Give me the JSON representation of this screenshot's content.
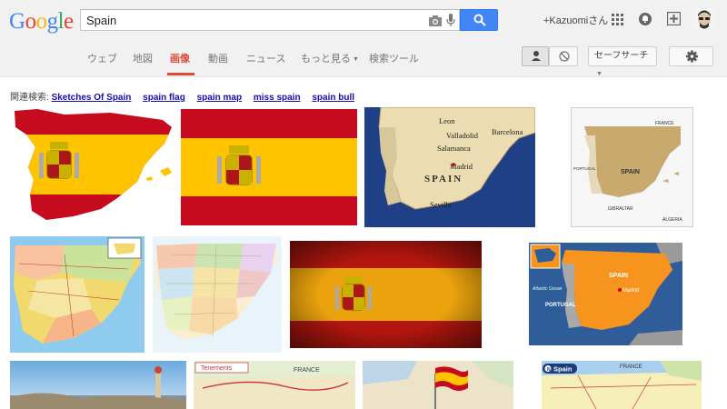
{
  "logo": {
    "text": "Google"
  },
  "search": {
    "query": "Spain"
  },
  "user": {
    "name": "+Kazuomiさん"
  },
  "nav": {
    "items": [
      "ウェブ",
      "地図",
      "画像",
      "動画",
      "ニュース",
      "もっと見る",
      "検索ツール"
    ],
    "active_index": 2
  },
  "toolbar": {
    "safe_search_label": "セーフサーチ"
  },
  "related": {
    "label": "関連検索:",
    "links": [
      "Sketches Of Spain",
      "spain flag",
      "spain map",
      "miss spain",
      "spain bull"
    ]
  },
  "images": [
    {
      "name": "spain-flag-map-silhouette"
    },
    {
      "name": "spain-flag"
    },
    {
      "name": "spain-map-cities",
      "labels": [
        "Leon",
        "Valladolid",
        "Salamanca",
        "Barcelona",
        "Madrid",
        "SPAIN",
        "Sevilla"
      ]
    },
    {
      "name": "spain-map-beige",
      "labels": [
        "FRANCE",
        "PORTUGAL",
        "SPAIN",
        "GIBRALTAR",
        "ALGERIA"
      ]
    },
    {
      "name": "spain-political-map"
    },
    {
      "name": "spain-regions-map"
    },
    {
      "name": "spain-flag-grunge"
    },
    {
      "name": "spain-orange-map",
      "labels": [
        "SPAIN",
        "Madrid",
        "PORTUGAL",
        "Atlantic Ocean"
      ]
    },
    {
      "name": "barcelona-park-photo"
    },
    {
      "name": "tenements-route-map",
      "labels": [
        "Tenements",
        "FRANCE"
      ]
    },
    {
      "name": "spain-flag-pin-map"
    },
    {
      "name": "spain-road-map",
      "labels": [
        "Spain",
        "FRANCE"
      ]
    }
  ],
  "colors": {
    "accent": "#dd4b39",
    "search_button": "#4285f4",
    "link": "#1a0dab",
    "flag_red": "#c60b1e",
    "flag_yellow": "#ffc400"
  }
}
